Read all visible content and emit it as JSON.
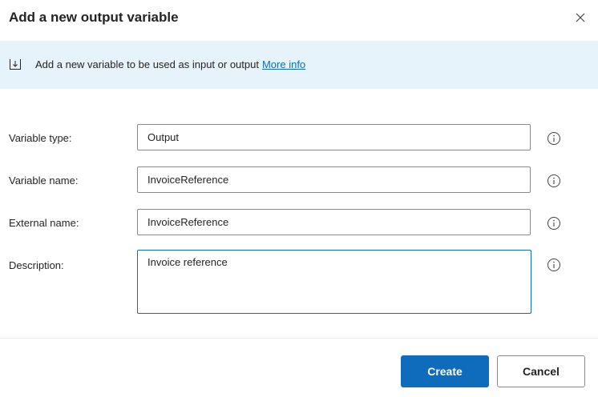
{
  "dialog": {
    "title": "Add a new output variable",
    "close_label": "×"
  },
  "info_bar": {
    "text": "Add a new variable to be used as input or output",
    "link_text": "More info"
  },
  "form": {
    "variable_type": {
      "label": "Variable type:",
      "value": "Output"
    },
    "variable_name": {
      "label": "Variable name:",
      "value": "InvoiceReference"
    },
    "external_name": {
      "label": "External name:",
      "value": "InvoiceReference"
    },
    "description": {
      "label": "Description:",
      "value": "Invoice reference"
    }
  },
  "buttons": {
    "create": "Create",
    "cancel": "Cancel"
  },
  "colors": {
    "accent": "#0f6cbd",
    "info_bar_bg": "#e7f3fb"
  },
  "icons": {
    "close": "close-icon",
    "info_bar": "download-arrow-icon",
    "help": "info-circle-icon"
  }
}
